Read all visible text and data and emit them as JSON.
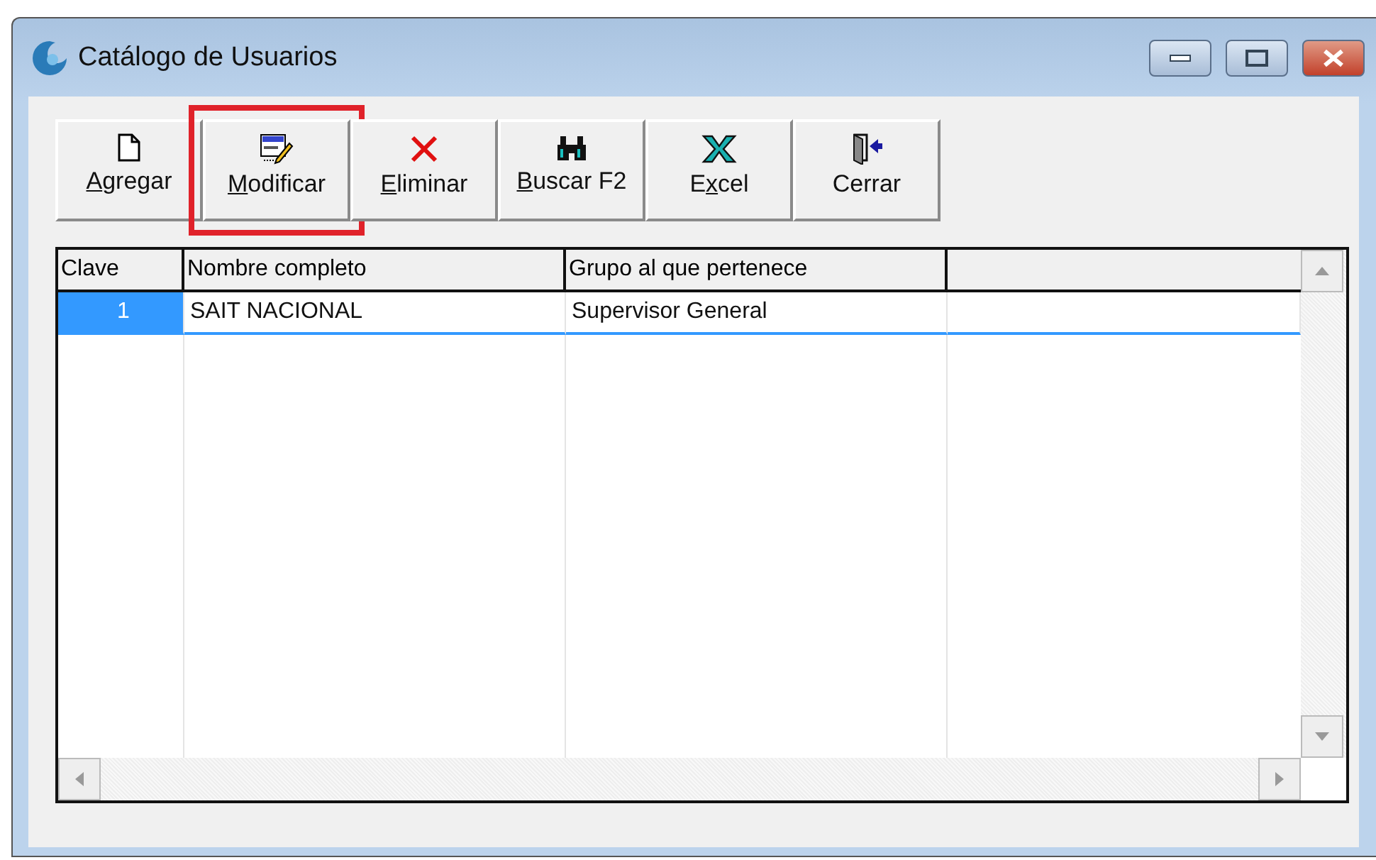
{
  "window": {
    "title": "Catálogo de Usuarios"
  },
  "toolbar": [
    {
      "kind": "new",
      "label": {
        "key": "A",
        "after": "gregar"
      },
      "highlighted": false
    },
    {
      "kind": "edit",
      "label": {
        "key": "M",
        "after": "odificar"
      },
      "highlighted": true
    },
    {
      "kind": "delete",
      "label": {
        "key": "E",
        "after": "liminar"
      },
      "highlighted": false
    },
    {
      "kind": "find",
      "label": {
        "key": "B",
        "after": "uscar F2"
      },
      "highlighted": false
    },
    {
      "kind": "excel",
      "label": {
        "before": "E",
        "key": "x",
        "after": "cel"
      },
      "highlighted": false
    },
    {
      "kind": "exit",
      "label": {
        "before": "Cerrar"
      },
      "highlighted": false
    }
  ],
  "table": {
    "columns": [
      "Clave",
      "Nombre completo",
      "Grupo al que pertenece"
    ],
    "rows": [
      {
        "cells": [
          "1",
          "SAIT NACIONAL",
          "Supervisor General"
        ],
        "selected": true
      }
    ]
  }
}
